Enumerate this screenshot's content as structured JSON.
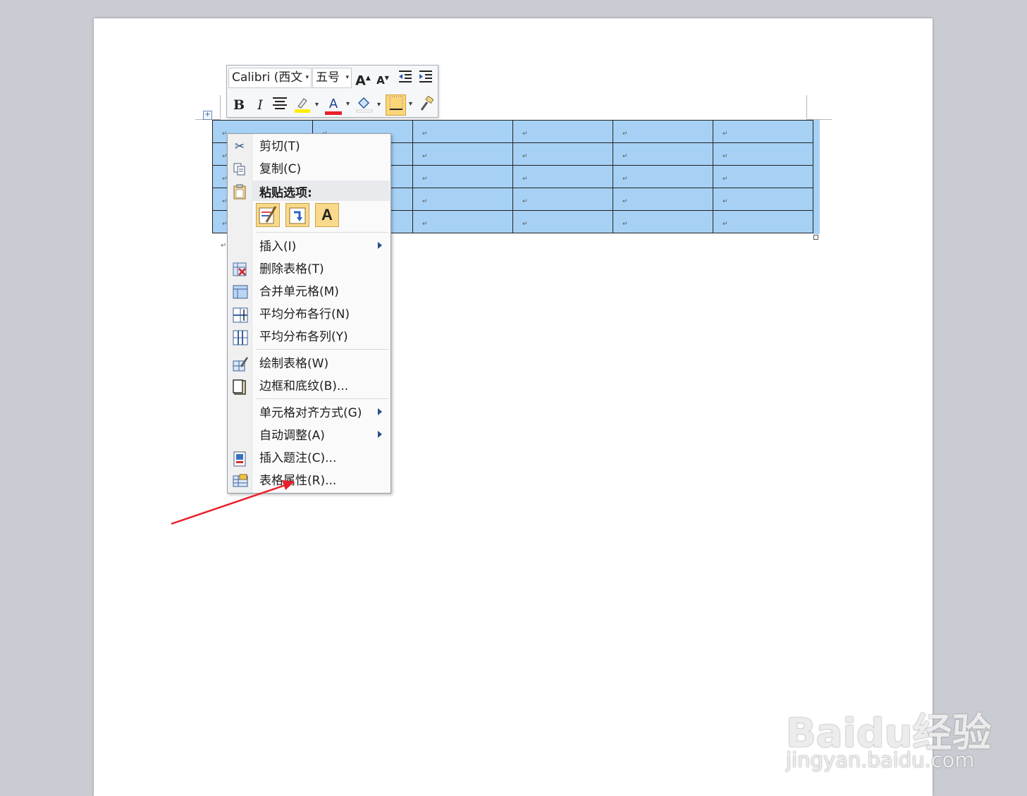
{
  "mini_toolbar": {
    "font_name": "Calibri (西文",
    "font_size": "五号",
    "buttons": [
      "A",
      "A",
      "B",
      "I",
      "A"
    ]
  },
  "table": {
    "rows": 5,
    "columns": 6,
    "cell_mark": "↵"
  },
  "context_menu": {
    "cut": "剪切(T)",
    "copy": "复制(C)",
    "paste_options": "粘贴选项:",
    "insert": "插入(I)",
    "delete_table": "删除表格(T)",
    "merge_cells": "合并单元格(M)",
    "distribute_rows": "平均分布各行(N)",
    "distribute_columns": "平均分布各列(Y)",
    "draw_table": "绘制表格(W)",
    "borders_shading": "边框和底纹(B)...",
    "cell_alignment": "单元格对齐方式(G)",
    "autofit": "自动调整(A)",
    "insert_caption": "插入题注(C)...",
    "table_properties": "表格属性(R)..."
  },
  "watermark": {
    "brand": "Baidu经验",
    "url": "jingyan.baidu.com"
  },
  "colors": {
    "selection": "#a6d1f5",
    "arrow": "#e8202a",
    "page": "#ffffff",
    "workspace": "#c9ccd2"
  }
}
